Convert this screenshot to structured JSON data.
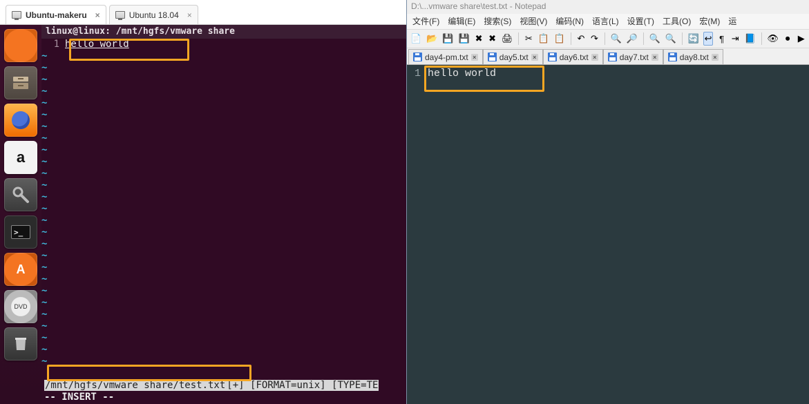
{
  "vm_tabs": [
    {
      "label": "Ubuntu-makeru",
      "active": true
    },
    {
      "label": "Ubuntu 18.04",
      "active": false
    }
  ],
  "terminal": {
    "title": "linux@linux: /mnt/hgfs/vmware share",
    "line_number": "1",
    "content": "hello world",
    "status": {
      "path": "/mnt/hgfs/vmware share/test.txt",
      "flags": "[+] [FORMAT=unix] [TYPE=TE"
    },
    "mode": "-- INSERT --"
  },
  "launcher_apps": [
    "ubuntu-dash",
    "files",
    "firefox",
    "amazon",
    "settings",
    "terminal",
    "software-updater",
    "disc",
    "trash"
  ],
  "npp": {
    "title_partial": "D:\\...vmware share\\test.txt - Notepad",
    "menus": [
      "文件(F)",
      "编辑(E)",
      "搜索(S)",
      "视图(V)",
      "编码(N)",
      "语言(L)",
      "设置(T)",
      "工具(O)",
      "宏(M)",
      "运"
    ],
    "tabs": [
      {
        "label": "day4-pm.txt",
        "active": false
      },
      {
        "label": "day5.txt",
        "active": false
      },
      {
        "label": "day6.txt",
        "active": false
      },
      {
        "label": "day7.txt",
        "active": false
      },
      {
        "label": "day8.txt",
        "active": false
      }
    ],
    "editor": {
      "line_number": "1",
      "content": "hello world"
    }
  },
  "toolbar_icons": [
    "new",
    "open",
    "save",
    "save-all",
    "close",
    "close-all",
    "print",
    "",
    "cut",
    "copy",
    "paste",
    "",
    "undo",
    "redo",
    "",
    "find",
    "replace",
    "",
    "zoom-in",
    "zoom-out",
    "",
    "sync",
    "wrap",
    "show-all",
    "indent",
    "lang",
    "",
    "monitor",
    "rec",
    "play"
  ]
}
